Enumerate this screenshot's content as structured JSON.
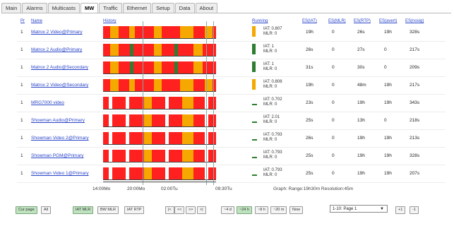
{
  "tabs": [
    "Main",
    "Alarms",
    "Multicasts",
    "MW",
    "Traffic",
    "Ethernet",
    "Setup",
    "Data",
    "About"
  ],
  "active_tab": "MW",
  "header": {
    "pr": "Pr",
    "name": "Name",
    "history": "History",
    "running": "Running",
    "es_iat": "ES(IAT)",
    "es_mlr": "ES(MLR)",
    "es_rtp": "ES(RTP)",
    "es_avert": "ES(avert)",
    "es_nosig": "ES(nosig)"
  },
  "colors": {
    "red": "#ff2020",
    "orange": "#f5a800",
    "green": "#2e7d32",
    "link": "#2a45c8"
  },
  "rows": [
    {
      "pr": "1",
      "name": "Matrox 2 Video@Primary",
      "iat": "IAT: 0.807",
      "mlr": "MLR: 0",
      "indicator": "orange",
      "es_iat": "19h",
      "es_mlr": "0",
      "es_rtp": "26s",
      "es_avert": "19h",
      "es_nosig": "328s",
      "bar": "A"
    },
    {
      "pr": "1",
      "name": "Matrox 2 Audio@Primary",
      "iat": "IAT: 1",
      "mlr": "MLR: 0",
      "indicator": "green",
      "es_iat": "26s",
      "es_mlr": "0",
      "es_rtp": "27s",
      "es_avert": "0",
      "es_nosig": "217s",
      "bar": "B"
    },
    {
      "pr": "1",
      "name": "Matrox 2 Audio@Secondary",
      "iat": "IAT: 1",
      "mlr": "MLR: 0",
      "indicator": "green",
      "es_iat": "31s",
      "es_mlr": "0",
      "es_rtp": "30s",
      "es_avert": "0",
      "es_nosig": "209s",
      "bar": "B"
    },
    {
      "pr": "1",
      "name": "Matrox 2 Video@Secondary",
      "iat": "IAT: 0.808",
      "mlr": "MLR: 0",
      "indicator": "orange",
      "es_iat": "19h",
      "es_mlr": "0",
      "es_rtp": "48m",
      "es_avert": "19h",
      "es_nosig": "217s",
      "bar": "A"
    },
    {
      "pr": "1",
      "name": "MRG7000 video",
      "iat": "IAT: 0.702",
      "mlr": "MLR: 0",
      "indicator": "dash",
      "es_iat": "23s",
      "es_mlr": "0",
      "es_rtp": "19h",
      "es_avert": "19h",
      "es_nosig": "343s",
      "bar": "C"
    },
    {
      "pr": "1",
      "name": "Showman Audio@Primary",
      "iat": "IAT: 2.01",
      "mlr": "MLR: 0",
      "indicator": "dash",
      "es_iat": "25s",
      "es_mlr": "0",
      "es_rtp": "13h",
      "es_avert": "0",
      "es_nosig": "218s",
      "bar": "C"
    },
    {
      "pr": "1",
      "name": "Showman Video 2@Primary",
      "iat": "IAT: 0.793",
      "mlr": "MLR: 0",
      "indicator": "dash",
      "es_iat": "26s",
      "es_mlr": "0",
      "es_rtp": "19h",
      "es_avert": "19h",
      "es_nosig": "213s",
      "bar": "C"
    },
    {
      "pr": "1",
      "name": "Showman PGM@Primary",
      "iat": "IAT: 0.793",
      "mlr": "MLR: 0",
      "indicator": "dash",
      "es_iat": "25s",
      "es_mlr": "0",
      "es_rtp": "19h",
      "es_avert": "19h",
      "es_nosig": "328s",
      "bar": "C"
    },
    {
      "pr": "1",
      "name": "Showman Video 1@Primary",
      "iat": "IAT: 0.793",
      "mlr": "MLR: 0",
      "indicator": "dash",
      "es_iat": "25s",
      "es_mlr": "0",
      "es_rtp": "19h",
      "es_avert": "19h",
      "es_nosig": "207s",
      "bar": "C"
    }
  ],
  "bar_patterns": {
    "A": [
      [
        "red",
        0,
        0.06
      ],
      [
        "orange",
        0.06,
        0.14
      ],
      [
        "red",
        0.14,
        0.23
      ],
      [
        "orange",
        0.23,
        0.28
      ],
      [
        "red",
        0.28,
        0.45
      ],
      [
        "orange",
        0.45,
        0.52
      ],
      [
        "red",
        0.52,
        0.68
      ],
      [
        "orange",
        0.68,
        0.8
      ],
      [
        "red",
        0.8,
        0.9
      ],
      [
        "orange",
        0.9,
        0.97
      ],
      [
        "red",
        0.97,
        1.0
      ]
    ],
    "B": [
      [
        "red",
        0,
        0.06
      ],
      [
        "orange",
        0.06,
        0.14
      ],
      [
        "red",
        0.14,
        0.24
      ],
      [
        "green",
        0.24,
        0.27
      ],
      [
        "red",
        0.27,
        0.45
      ],
      [
        "orange",
        0.45,
        0.52
      ],
      [
        "red",
        0.52,
        0.63
      ],
      [
        "green",
        0.63,
        0.66
      ],
      [
        "red",
        0.66,
        0.8
      ],
      [
        "orange",
        0.8,
        0.88
      ],
      [
        "red",
        0.88,
        1.0
      ]
    ],
    "C": [
      [
        "red",
        0,
        0.05
      ],
      [
        "white",
        0.05,
        0.08
      ],
      [
        "red",
        0.08,
        0.2
      ],
      [
        "white",
        0.2,
        0.23
      ],
      [
        "red",
        0.23,
        0.36
      ],
      [
        "orange",
        0.36,
        0.43
      ],
      [
        "red",
        0.43,
        0.55
      ],
      [
        "white",
        0.55,
        0.58
      ],
      [
        "red",
        0.58,
        0.7
      ],
      [
        "orange",
        0.7,
        0.8
      ],
      [
        "red",
        0.8,
        0.9
      ],
      [
        "white",
        0.9,
        0.93
      ],
      [
        "red",
        0.93,
        1.0
      ]
    ]
  },
  "axis_ticks": [
    "14:00Mo",
    "20:00Mo",
    "02:00Tu",
    "09:30Tu"
  ],
  "graph_info": "Graph: Range:19h30m Resolution:45m",
  "controls": {
    "cur_page": "Cur page",
    "all": "All",
    "iat_mlr": "IAT MLR",
    "bw_mlr": "BW MLR",
    "iat_rtp": "IAT RTP",
    "nav": [
      "|<",
      "<<",
      ">>",
      ">|"
    ],
    "ranges": [
      "~4 d",
      "~24 h",
      "~8 h",
      "~20 m",
      "Now"
    ],
    "page_select": "1-10: Page 1",
    "plus1": "+1",
    "minus1": "-1"
  }
}
